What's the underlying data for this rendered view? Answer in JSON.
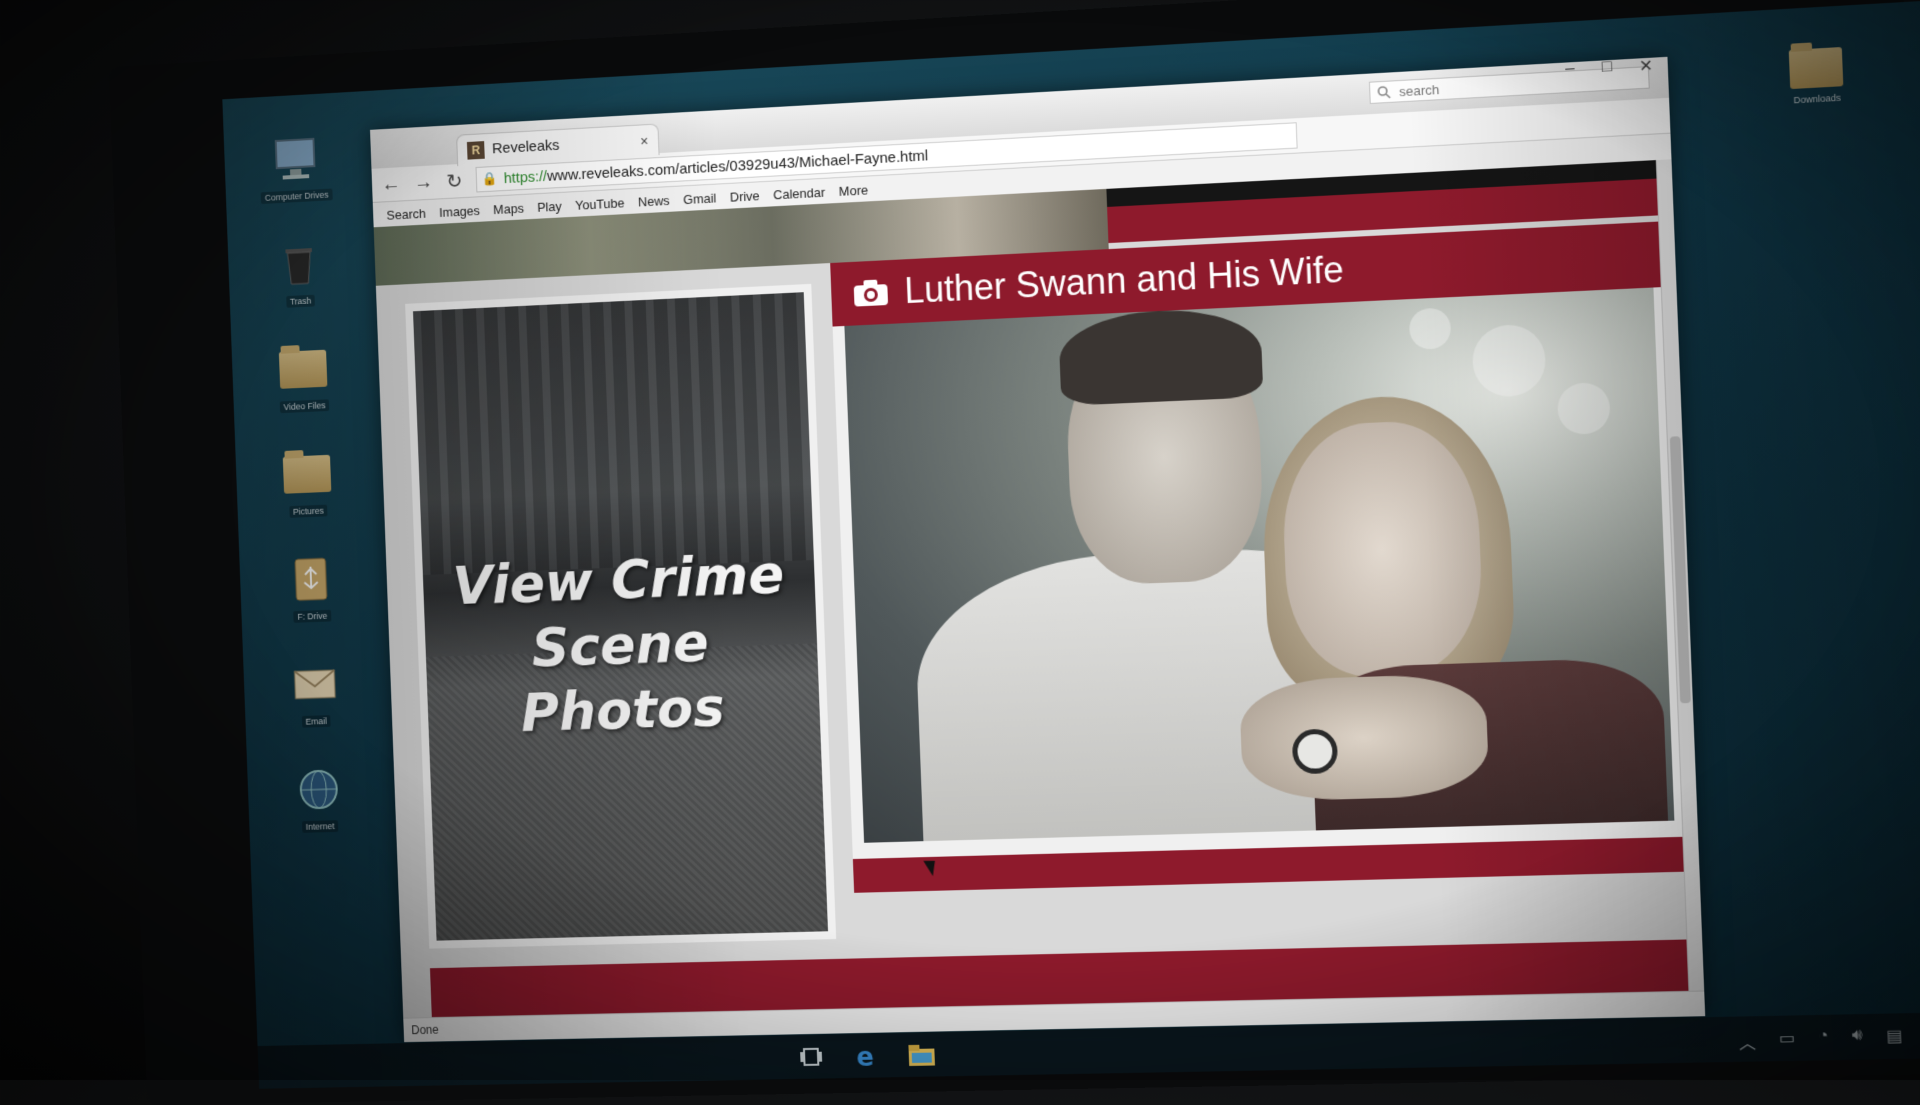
{
  "desktop": {
    "left_icons": [
      {
        "label": "Computer Drives",
        "icon": "computer-icon"
      },
      {
        "label": "Trash",
        "icon": "trash-icon"
      },
      {
        "label": "Video Files",
        "icon": "folder-icon"
      },
      {
        "label": "Pictures",
        "icon": "folder-icon"
      },
      {
        "label": "F: Drive",
        "icon": "usb-drive-icon"
      },
      {
        "label": "Email",
        "icon": "email-icon"
      },
      {
        "label": "Internet",
        "icon": "globe-icon"
      }
    ],
    "right_icon": {
      "label": "Downloads",
      "icon": "folder-icon"
    }
  },
  "browser": {
    "tab_favicon": "R",
    "tab_title": "Reveleaks",
    "tab_close": "×",
    "search_placeholder": "search",
    "url_scheme": "https://",
    "url_rest": "www.reveleaks.com/articles/03929u43/Michael-Fayne.html",
    "bookmarks": [
      "Search",
      "Images",
      "Maps",
      "Play",
      "YouTube",
      "News",
      "Gmail",
      "Drive",
      "Calendar",
      "More"
    ],
    "status": "Done"
  },
  "page": {
    "left_card_title_line1": "View Crime",
    "left_card_title_line2": "Scene Photos",
    "right_card_title": "Luther Swann and His Wife"
  },
  "colors": {
    "accent_red": "#8e1a2c",
    "desktop_teal": "#0f3646"
  }
}
